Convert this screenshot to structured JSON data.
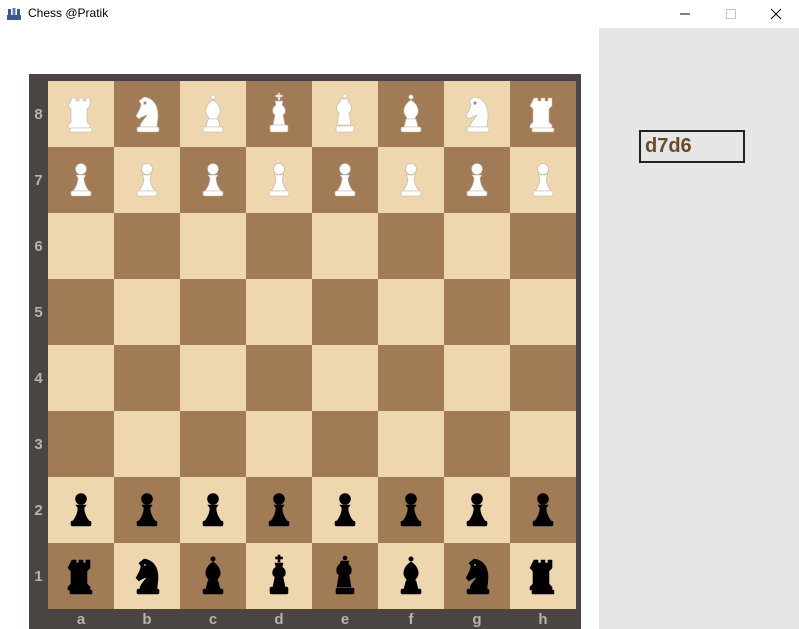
{
  "window": {
    "title": "Chess @Pratik",
    "app_icon": "chess-app-icon",
    "controls": [
      "minimize-icon",
      "maximize-icon",
      "close-icon"
    ]
  },
  "colors": {
    "light_square": "#eed6ae",
    "dark_square": "#a17a56",
    "frame": "#4a4543",
    "label": "#b9b3ad",
    "side_panel": "#e6e6e6",
    "move_text": "#6b4a2a",
    "white_piece": "#ffffff",
    "black_piece": "#000000"
  },
  "last_move": "d7d6",
  "ranks": [
    "8",
    "7",
    "6",
    "5",
    "4",
    "3",
    "2",
    "1"
  ],
  "files": [
    "a",
    "b",
    "c",
    "d",
    "e",
    "f",
    "g",
    "h"
  ],
  "board": [
    [
      "wR",
      "wN",
      "wB",
      "wK",
      "wQ",
      "wB",
      "wN",
      "wR"
    ],
    [
      "wP",
      "wP",
      "wP",
      "wP",
      "wP",
      "wP",
      "wP",
      "wP"
    ],
    [
      "",
      "",
      "",
      "",
      "",
      "",
      "",
      ""
    ],
    [
      "",
      "",
      "",
      "",
      "",
      "",
      "",
      ""
    ],
    [
      "",
      "",
      "",
      "",
      "",
      "",
      "",
      ""
    ],
    [
      "",
      "",
      "",
      "",
      "",
      "",
      "",
      ""
    ],
    [
      "bP",
      "bP",
      "bP",
      "bP",
      "bP",
      "bP",
      "bP",
      "bP"
    ],
    [
      "bR",
      "bN",
      "bB",
      "bK",
      "bQ",
      "bB",
      "bN",
      "bR"
    ]
  ],
  "piece_names": {
    "P": "pawn",
    "R": "rook",
    "N": "knight",
    "B": "bishop",
    "Q": "queen",
    "K": "king"
  }
}
